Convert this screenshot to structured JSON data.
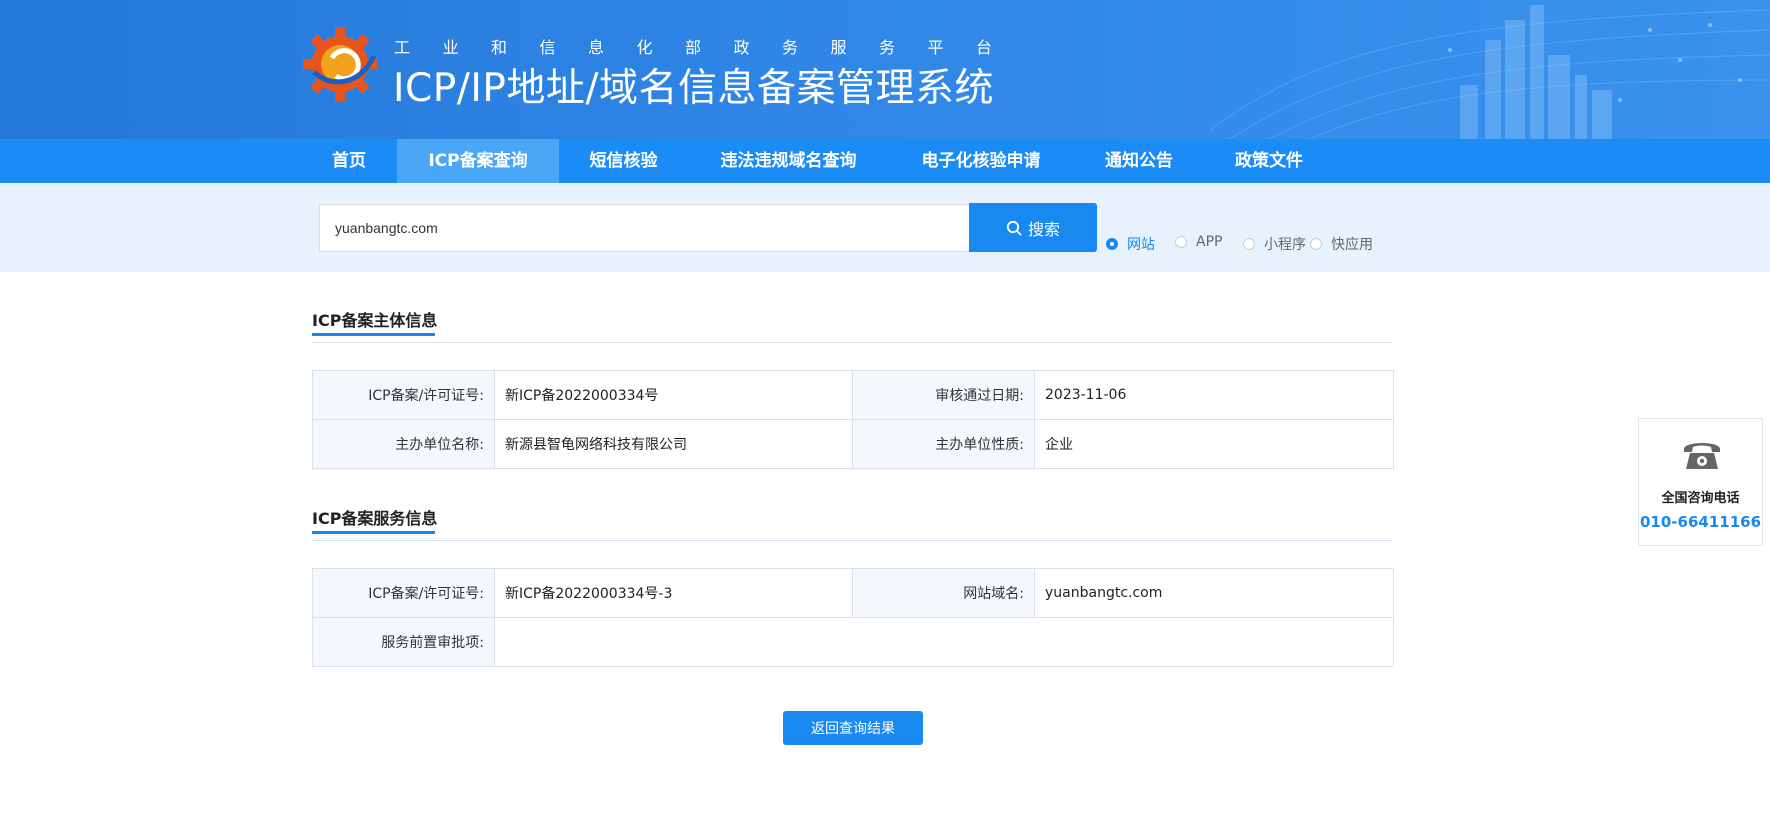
{
  "banner": {
    "subtitle": "工业和信息化部政务服务平台",
    "title": "ICP/IP地址/域名信息备案管理系统"
  },
  "nav": {
    "items": [
      {
        "label": "首页"
      },
      {
        "label": "ICP备案查询",
        "active": true
      },
      {
        "label": "短信核验"
      },
      {
        "label": "违法违规域名查询"
      },
      {
        "label": "电子化核验申请"
      },
      {
        "label": "通知公告"
      },
      {
        "label": "政策文件"
      }
    ]
  },
  "search": {
    "value": "yuanbangtc.com",
    "button_label": "搜索",
    "options": [
      {
        "label": "网站",
        "checked": true
      },
      {
        "label": "APP",
        "checked": false
      },
      {
        "label": "小程序",
        "checked": false
      },
      {
        "label": "快应用",
        "checked": false
      }
    ]
  },
  "subject_info": {
    "title": "ICP备案主体信息",
    "license_label": "ICP备案/许可证号:",
    "license_value": "新ICP备2022000334号",
    "approve_date_label": "审核通过日期:",
    "approve_date_value": "2023-11-06",
    "org_name_label": "主办单位名称:",
    "org_name_value": "新源县智龟网络科技有限公司",
    "org_type_label": "主办单位性质:",
    "org_type_value": "企业"
  },
  "service_info": {
    "title": "ICP备案服务信息",
    "license_label": "ICP备案/许可证号:",
    "license_value": "新ICP备2022000334号-3",
    "domain_label": "网站域名:",
    "domain_value": "yuanbangtc.com",
    "pre_approval_label": "服务前置审批项:",
    "pre_approval_value": ""
  },
  "return_button": "返回查询结果",
  "side": {
    "label": "全国咨询电话",
    "phone": "010-66411166"
  },
  "icons": [
    "logo-gear-icon",
    "search-icon",
    "phone-icon"
  ],
  "colors": {
    "primary": "#1789f0",
    "nav": "#1b8bf5",
    "nav_active": "#4aa6f7",
    "banner": "#2f86e6"
  }
}
